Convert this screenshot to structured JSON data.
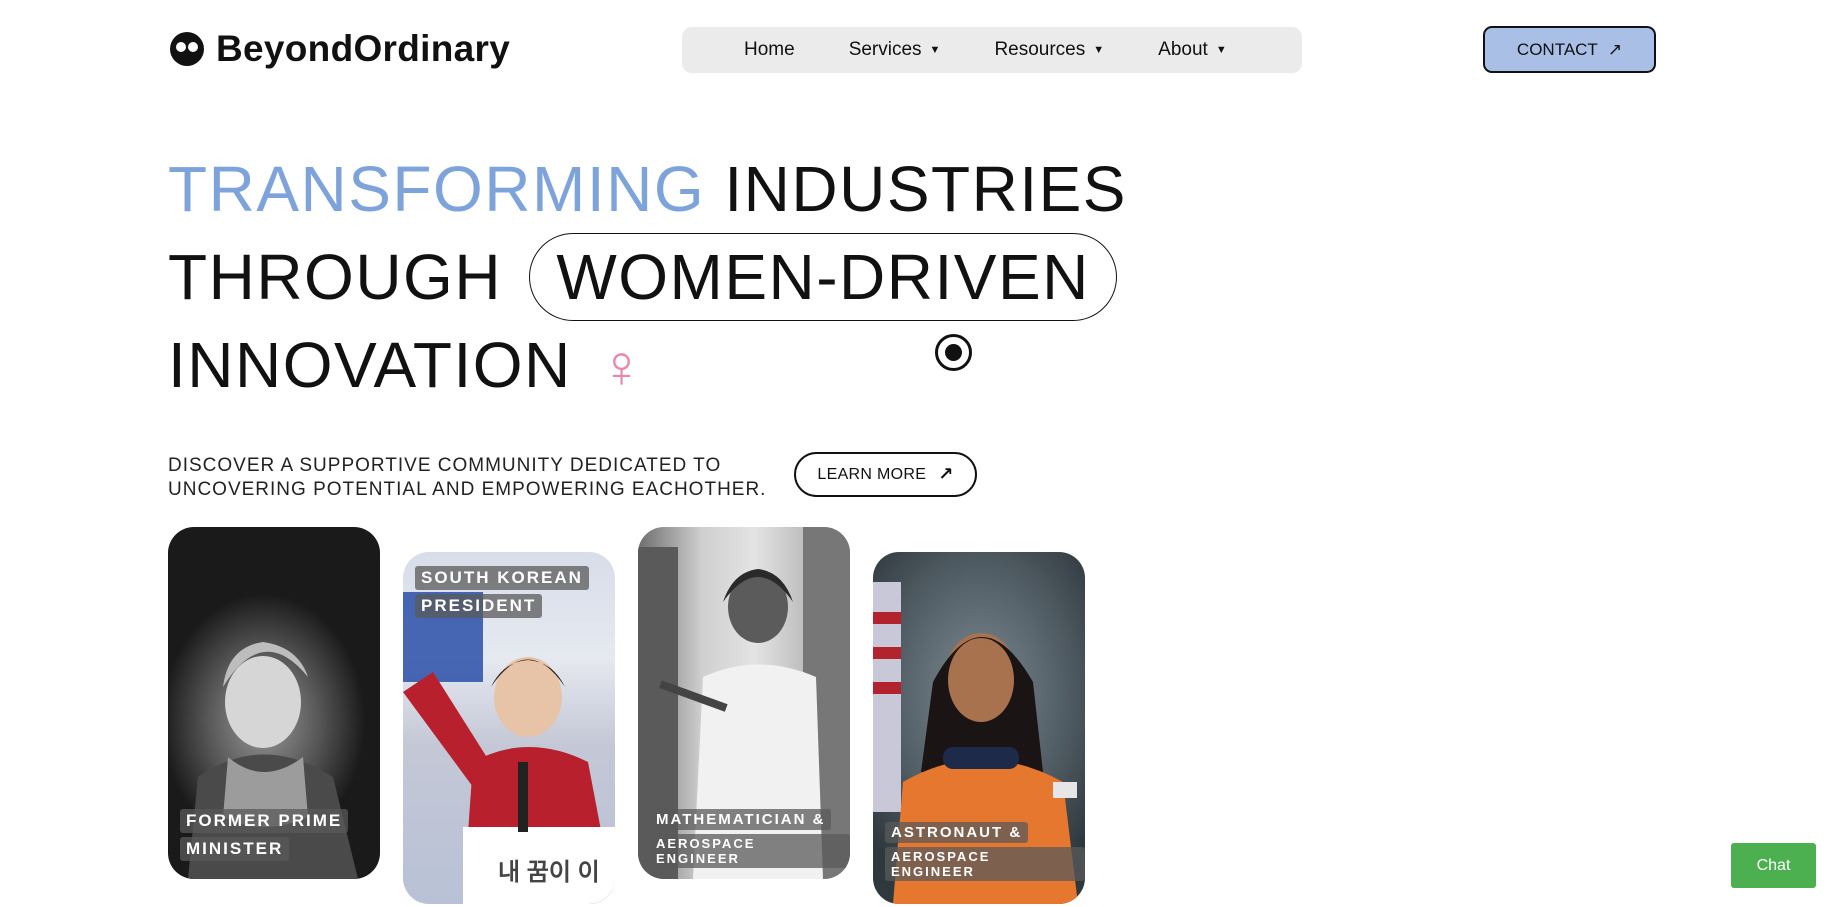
{
  "header": {
    "logo_text": "BeyondOrdinary",
    "nav": [
      {
        "label": "Home",
        "has_caret": false
      },
      {
        "label": "Services",
        "has_caret": true
      },
      {
        "label": "Resources",
        "has_caret": true
      },
      {
        "label": "About",
        "has_caret": true
      }
    ],
    "contact_label": "CONTACT",
    "contact_arrow": "↗"
  },
  "hero": {
    "line1_accent": "TRANSFORMING",
    "line1_rest": "INDUSTRIES",
    "line2_start": "THROUGH",
    "line2_pill": "WOMEN-DRIVEN",
    "line3": "INNOVATION",
    "venus_symbol": "♀"
  },
  "tagline": {
    "line1": "DISCOVER A SUPPORTIVE COMMUNITY DEDICATED TO",
    "line2": "UNCOVERING POTENTIAL AND EMPOWERING EACHOTHER."
  },
  "learn_more": {
    "label": "LEARN MORE",
    "arrow": "↗"
  },
  "cards": [
    {
      "caption": [
        "FORMER PRIME",
        "MINISTER"
      ]
    },
    {
      "caption": [
        "SOUTH KOREAN",
        "PRESIDENT"
      ],
      "sign_text": "내 꿈이 이"
    },
    {
      "caption": [
        "MATHEMATICIAN &",
        "AEROSPACE ENGINEER"
      ]
    },
    {
      "caption": [
        "ASTRONAUT &",
        "AEROSPACE ENGINEER"
      ]
    }
  ],
  "chat": {
    "label": "Chat"
  },
  "colors": {
    "accent_blue": "#7ea3db",
    "contact_bg": "#a9bfe6",
    "venus_pink": "#e889ab",
    "chat_green": "#4caf50"
  }
}
